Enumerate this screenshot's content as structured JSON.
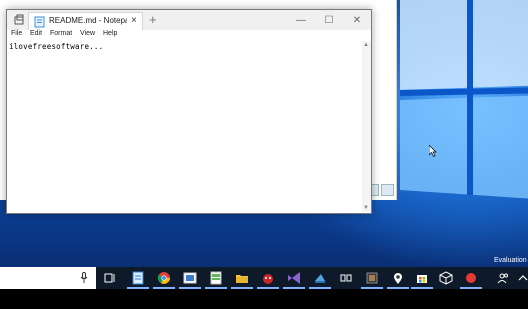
{
  "notepad": {
    "tab_title": "README.md - Notepad",
    "new_tab": "+",
    "close_tab": "×",
    "window_buttons": {
      "minimize": "—",
      "maximize": "☐",
      "close": "✕"
    },
    "menu": [
      "File",
      "Edit",
      "Format",
      "View",
      "Help"
    ],
    "content": "ilovefreesoftware..."
  },
  "system": {
    "watermark": "Evaluation"
  },
  "taskbar": {
    "items": [
      "task-view",
      "edge",
      "chrome",
      "photos",
      "excel-like",
      "file-explorer",
      "game",
      "visual-studio",
      "azure-tool",
      "window-manager",
      "app-a",
      "maps-pin",
      "store",
      "3d-box",
      "record"
    ],
    "tray": [
      "people-icon",
      "chevron-up-icon"
    ]
  },
  "colors": {
    "accent": "#1a73e8",
    "taskbar": "#0e1a2a",
    "desktop": "#0d55c0"
  }
}
